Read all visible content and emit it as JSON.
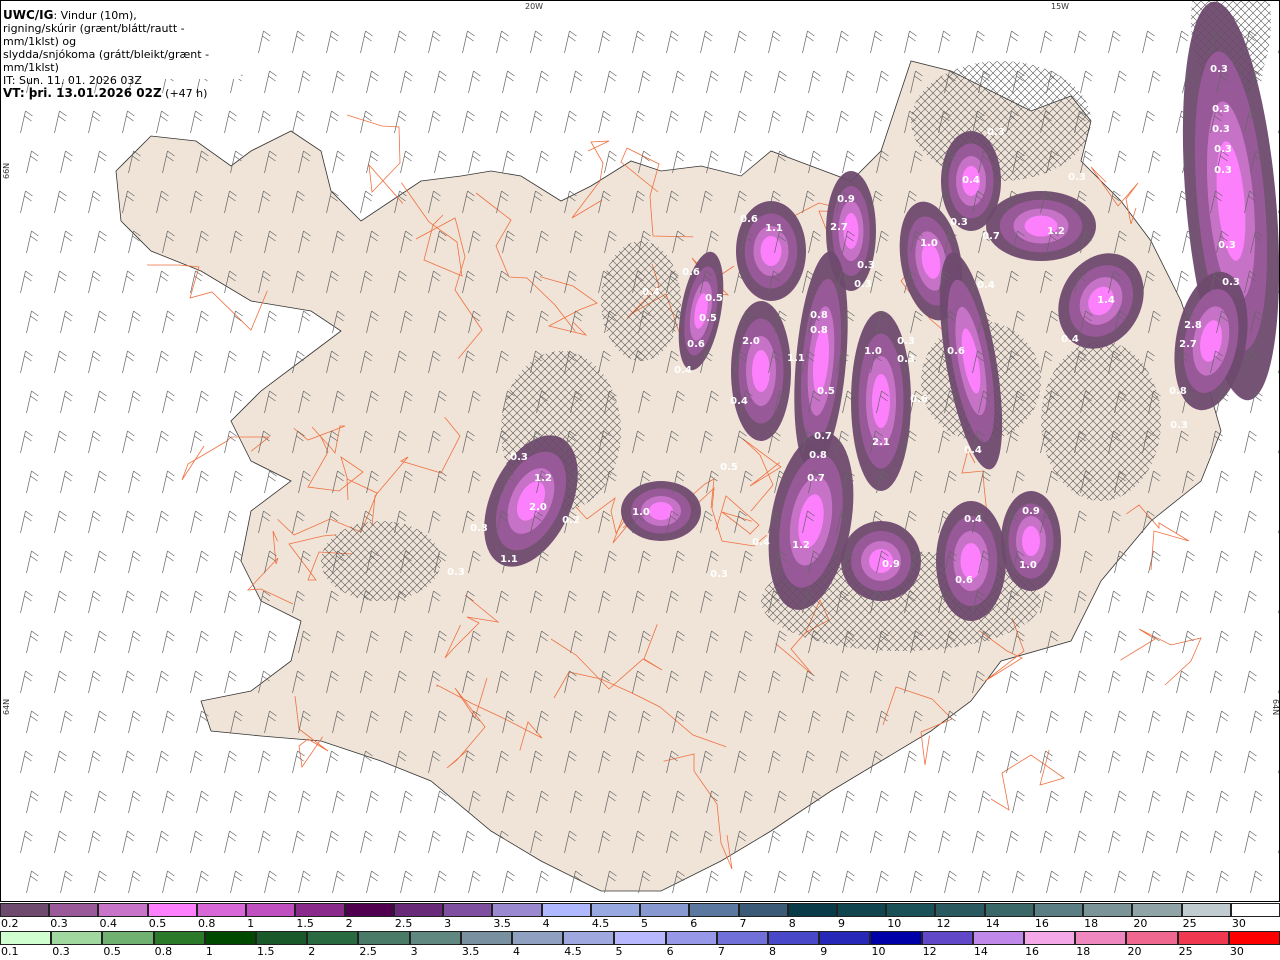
{
  "title": {
    "model": "UWC/IG",
    "line1": ": Vindur (10m),",
    "line2": "rigning/skúrir (grænt/blátt/rautt - mm/1klst) og",
    "line3": "slydda/snjókoma (grátt/bleikt/grænt - mm/1klst)",
    "init_time": "IT: Sun. 11. 01. 2026 03Z",
    "valid_time": "VT: þri. 13.01.2026 02Z",
    "lead": " (+47 h)"
  },
  "graticule": {
    "lon1": "20W",
    "lon2": "15W",
    "lat_top": "66N",
    "lat_bottom": "64N",
    "lat_right": "64N"
  },
  "precip_labels": [
    "0.3",
    "0.3",
    "0.3",
    "0.3",
    "0.3",
    "0.3",
    "0.3",
    "0.4",
    "0.9",
    "0.6",
    "1.1",
    "2.7",
    "1.0",
    "0.7",
    "1.2",
    "0.3",
    "0.3",
    "0.3",
    "0.3",
    "0.3",
    "0.4",
    "0.6",
    "0.4",
    "0.5",
    "0.5",
    "1.4",
    "2.8",
    "2.7",
    "0.4",
    "0.6",
    "2.0",
    "1.1",
    "0.8",
    "0.8",
    "1.0",
    "0.3",
    "0.3",
    "0.6",
    "0.4",
    "0.5",
    "0.4",
    "0.6",
    "0.8",
    "0.3",
    "0.7",
    "2.1",
    "0.8",
    "0.4",
    "0.3",
    "1.2",
    "0.7",
    "0.5",
    "2.0",
    "1.0",
    "0.4",
    "0.9",
    "0.2",
    "0.3",
    "1.1",
    "0.4",
    "1.2",
    "0.9",
    "1.0",
    "0.6",
    "0.3",
    "0.3"
  ],
  "colors": {
    "land": "#f0e4d8",
    "sea": "#ffffff",
    "roads": "#f07040",
    "hatch": "#555555"
  },
  "legend_snow": {
    "labels": [
      "0.2",
      "0.3",
      "0.4",
      "0.5",
      "0.8",
      "1",
      "1.5",
      "2",
      "2.5",
      "3",
      "3.5",
      "4",
      "4.5",
      "5",
      "6",
      "7",
      "8",
      "9",
      "10",
      "12",
      "14",
      "16",
      "18",
      "20",
      "25",
      "30"
    ],
    "colors": [
      "#6e4a6e",
      "#9a5a9a",
      "#c874c8",
      "#ff80ff",
      "#d867d8",
      "#c050c0",
      "#8a2a8a",
      "#50004f",
      "#6a2a7a",
      "#8050a0",
      "#9a88d0",
      "#b0b8ff",
      "#98a8e0",
      "#8898d0",
      "#5a78a0",
      "#3a5a78",
      "#083a48",
      "#104550",
      "#1a5058",
      "#2a5a60",
      "#3a6868",
      "#5a7e84",
      "#7a9498",
      "#90a4a8",
      "#c0ccd0",
      "#ffffff"
    ]
  },
  "legend_rain": {
    "labels": [
      "0.1",
      "0.3",
      "0.5",
      "0.8",
      "1",
      "1.5",
      "2",
      "2.5",
      "3",
      "3.5",
      "4",
      "4.5",
      "5",
      "6",
      "7",
      "8",
      "9",
      "10",
      "12",
      "14",
      "16",
      "18",
      "20",
      "25",
      "30"
    ],
    "colors": [
      "#d0ffd0",
      "#a0d8a0",
      "#70b070",
      "#2a7a2a",
      "#004a00",
      "#1a5a2a",
      "#2a6a40",
      "#4a7a68",
      "#608880",
      "#7890a0",
      "#90a0c0",
      "#a0a8e0",
      "#b8b8ff",
      "#9898e8",
      "#7070d8",
      "#4848c8",
      "#2828b8",
      "#0000a8",
      "#6048c8",
      "#c088e8",
      "#f4a8e8",
      "#f088c0",
      "#f06890",
      "#f03850",
      "#ff0000"
    ]
  }
}
